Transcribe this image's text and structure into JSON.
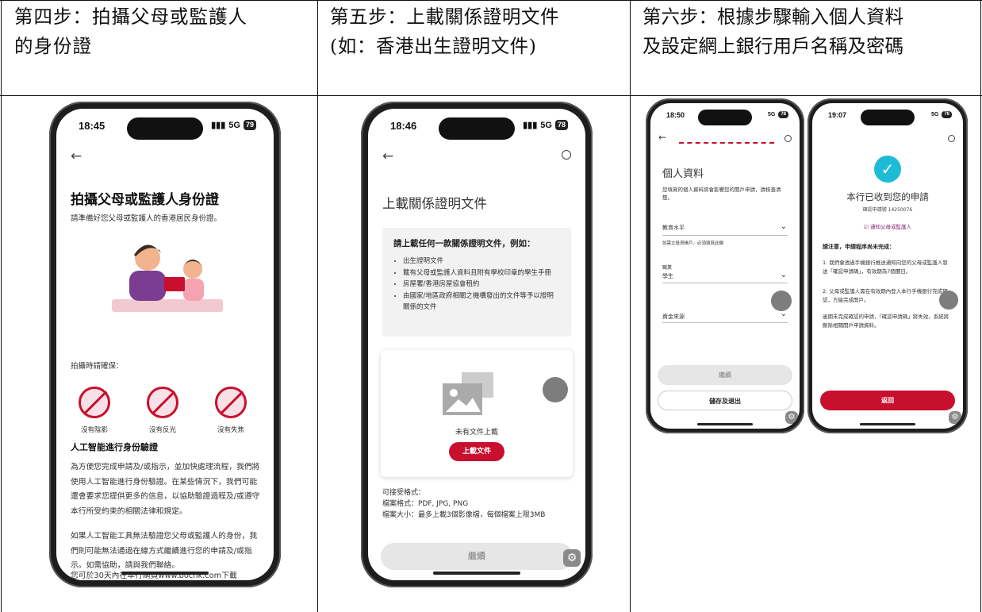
{
  "headers": [
    "第四步：拍攝父母或監護人\n的身份證",
    "第五步：上載關係證明文件\n(如：香港出生證明文件)",
    "第六步：根據步驟輸入個人資料\n及設定網上銀行用戶名稱及密碼"
  ],
  "phone1": {
    "time": "18:45",
    "net": "5G",
    "battery": "79",
    "title": "拍攝父母或監護人身份證",
    "subtitle": "請準備好您父母或監護人的香港居民身份證。",
    "ensure_label": "拍攝時請確保：",
    "conditions": [
      "沒有陰影",
      "沒有反光",
      "沒有失焦"
    ],
    "ai_title": "人工智能進行身份驗證",
    "ai_para1": "為方便您完成申請及/或指示，並加快處理流程，我們將使用人工智能進行身份驗證。在某些情況下，我們可能還會要求您提供更多的信息，以協助驗證過程及/或遵守本行所受約束的相關法律和規定。",
    "ai_para2": "如果人工智能工具無法驗證您父母或監護人的身份，我們則可能無法通過在線方式繼續進行您的申請及/或指示。如需協助，請與我們聯絡。",
    "ai_para3": "您可於30天內在本行網頁www.bochk.com下載"
  },
  "phone2": {
    "time": "18:46",
    "net": "5G",
    "battery": "78",
    "title": "上載關係證明文件",
    "box_title": "請上載任何一款關係證明文件，例如：",
    "items": [
      "出生證明文件",
      "載有父母或監護人資料且附有學校印章的學生手冊",
      "房屋署/香港房屋協會租約",
      "由國家/地區政府相關之機構發出的文件等予以證明關係的文件"
    ],
    "no_file": "未有文件上載",
    "upload_btn": "上載文件",
    "accept": "可接受格式：",
    "formats": "檔案格式：PDF, JPG, PNG",
    "size": "檔案大小：最多上載3個影像檔，每個檔案上限3MB",
    "continue_btn": "繼續"
  },
  "phone3": {
    "time": "18:50",
    "net": "5G",
    "battery": "78",
    "title": "個人資料",
    "note": "您填寫的個人資料將會影響您的開戶申請，請核查清楚。",
    "edu_label": "教育水平",
    "edu_hint": "如需立投資帳戶，必須填寫此欄",
    "job_label": "職業",
    "job_value": "學生",
    "fund_label": "資金來源",
    "continue_btn": "繼續",
    "save_btn": "儲存及退出"
  },
  "phone4": {
    "time": "19:07",
    "net": "5G",
    "battery": "76",
    "title": "本行已收到您的申請",
    "ref": "確認申請號 14250076",
    "notify": "通知父母或監護人",
    "notice_title": "請注意，申請程序尚未完成：",
    "n1": "1. 我們會透過手機銀行推送通知向您的父母或監護人發送「確認申請碼」，有效期為7個曆日。",
    "n2": "2. 父母或監護人需在有效期內登入本行手機銀行完成確認，方能完成開戶。",
    "n3": "逾期未完成確認的申請，「確認申請碼」將失效，系統將刪除相關開戶申請資料。",
    "back_btn": "返回"
  }
}
